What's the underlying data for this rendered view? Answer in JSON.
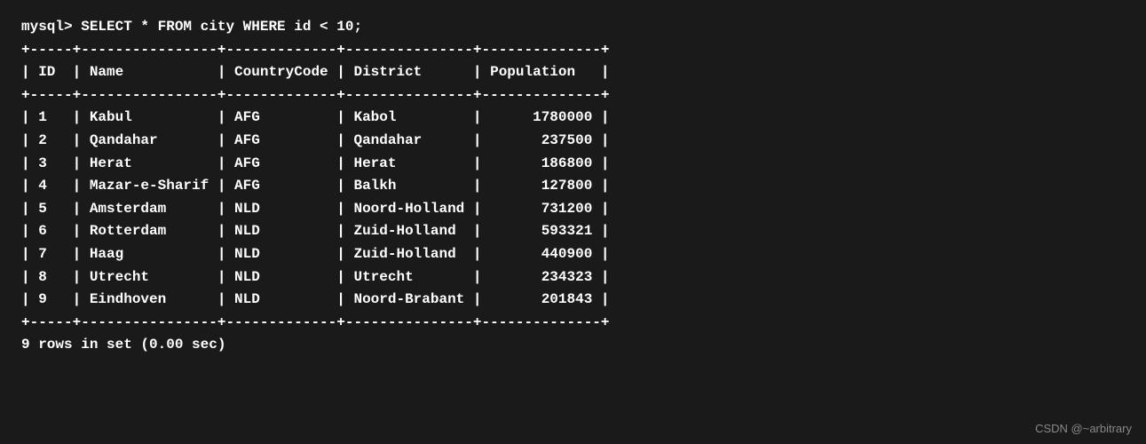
{
  "terminal": {
    "command": "mysql> SELECT * FROM city WHERE id < 10;",
    "separator_top": "+-----+----------------+-------------+---------------+--------------+",
    "header": "| ID  | Name           | CountryCode | District      | Population   |",
    "separator_mid": "+-----+----------------+-------------+---------------+--------------+",
    "rows": [
      "| 1   | Kabul          | AFG         | Kabol         |      1780000 |",
      "| 2   | Qandahar       | AFG         | Qandahar      |       237500 |",
      "| 3   | Herat          | AFG         | Herat         |       186800 |",
      "| 4   | Mazar-e-Sharif | AFG         | Balkh         |       127800 |",
      "| 5   | Amsterdam      | NLD         | Noord-Holland |       731200 |",
      "| 6   | Rotterdam      | NLD         | Zuid-Holland  |       593321 |",
      "| 7   | Haag           | NLD         | Zuid-Holland  |       440900 |",
      "| 8   | Utrecht        | NLD         | Utrecht       |       234323 |",
      "| 9   | Eindhoven      | NLD         | Noord-Brabant |       201843 |"
    ],
    "separator_bot": "+-----+----------------+-------------+---------------+--------------+",
    "footer": "9 rows in set (0.00 sec)",
    "watermark": "CSDN @~arbitrary"
  }
}
